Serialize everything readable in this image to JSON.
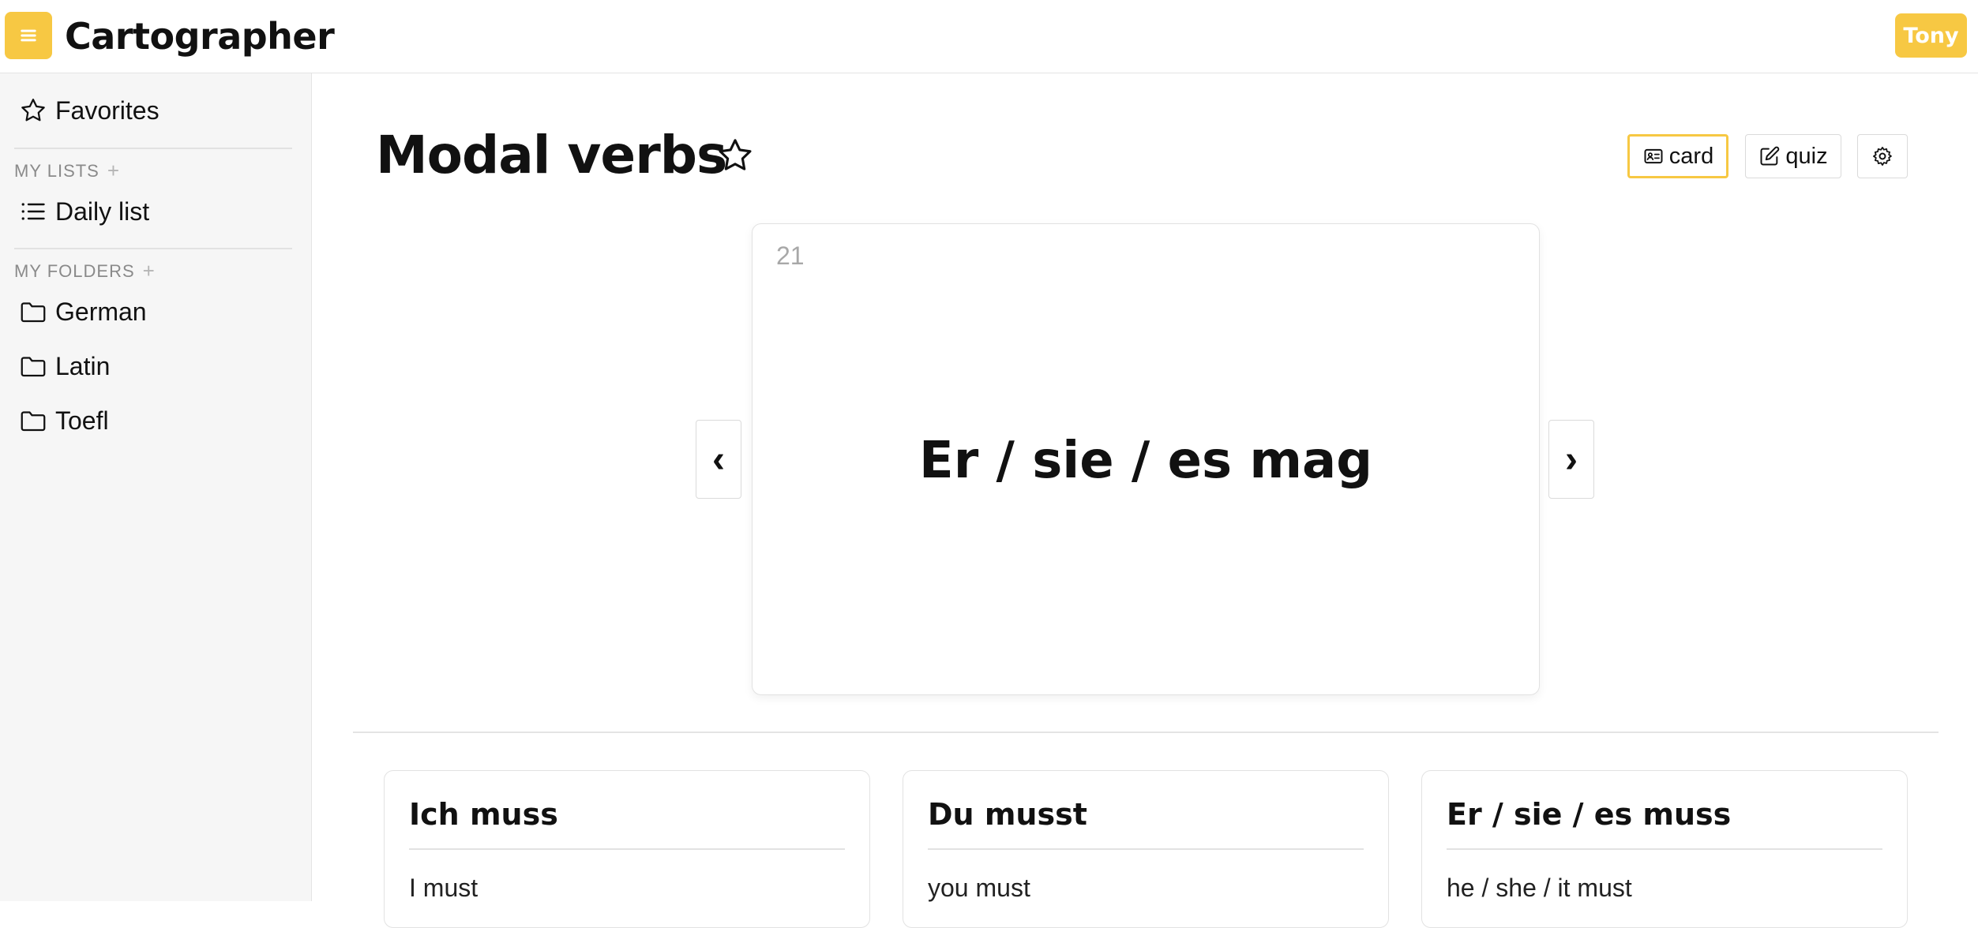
{
  "app": {
    "title": "Cartographer",
    "user": "Tony"
  },
  "sidebar": {
    "favorites": "Favorites",
    "lists_heading": "MY LISTS",
    "lists": [
      {
        "label": "Daily list"
      }
    ],
    "folders_heading": "MY FOLDERS",
    "folders": [
      {
        "label": "German"
      },
      {
        "label": "Latin"
      },
      {
        "label": "Toefl"
      }
    ],
    "add_symbol": "+"
  },
  "main": {
    "title": "Modal verbs",
    "modes": {
      "card": "card",
      "quiz": "quiz"
    },
    "card": {
      "number": "21",
      "text": "Er / sie / es mag"
    },
    "nav": {
      "prev": "‹",
      "next": "›"
    },
    "terms": [
      {
        "term": "Ich muss",
        "definition": "I must"
      },
      {
        "term": "Du musst",
        "definition": "you must"
      },
      {
        "term": "Er / sie / es muss",
        "definition": "he / she / it must"
      }
    ]
  },
  "colors": {
    "accent": "#f7c843",
    "border": "#e2e2e2",
    "sidebar_bg": "#f6f6f6"
  },
  "icons": {
    "menu": "hamburger-icon",
    "favorites": "star-icon",
    "list": "list-icon",
    "folder": "folder-icon",
    "card": "id-card-icon",
    "quiz": "edit-icon",
    "settings": "gear-icon"
  }
}
